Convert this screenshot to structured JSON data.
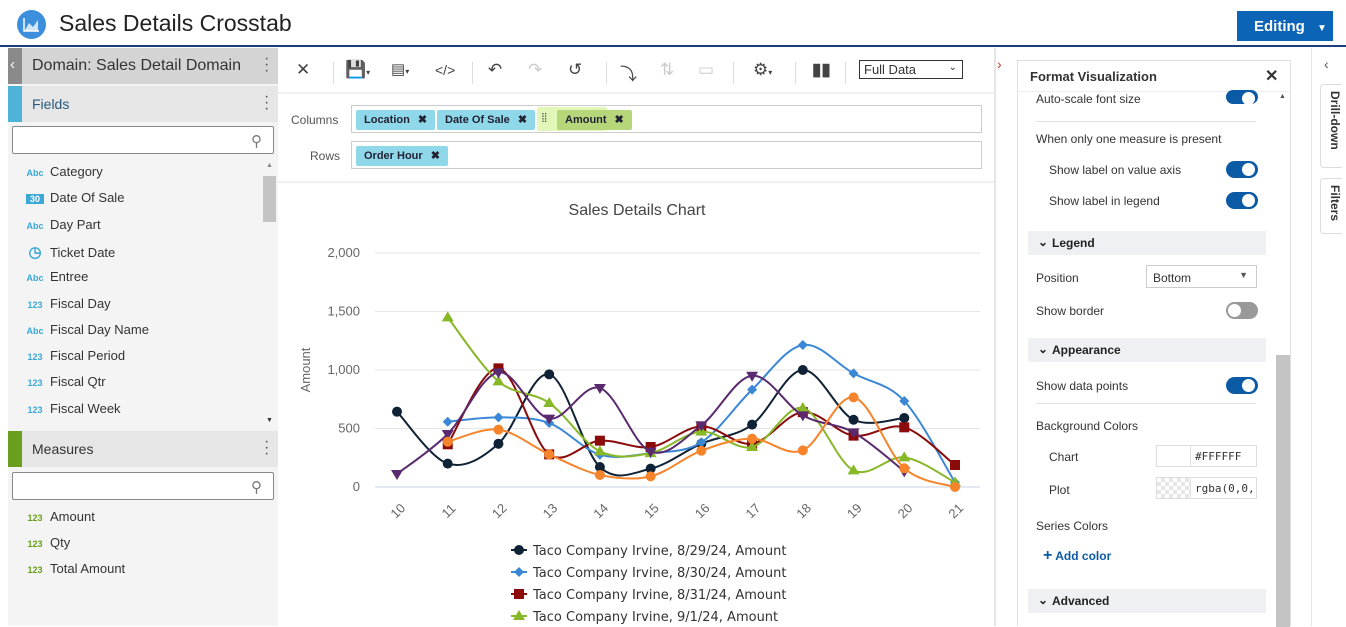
{
  "header": {
    "title": "Sales Details Crosstab",
    "editing_label": "Editing",
    "editing_caret": "▼"
  },
  "left_panel": {
    "domain_label": "Domain: Sales Detail Domain",
    "fields_label": "Fields",
    "fields_search_placeholder": "",
    "fields": [
      {
        "type": "Abc",
        "label": "Category"
      },
      {
        "type": "30",
        "label": "Date Of Sale"
      },
      {
        "type": "Abc",
        "label": "Day Part"
      },
      {
        "type": "clock",
        "label": "Ticket Date"
      },
      {
        "type": "Abc",
        "label": "Entree"
      },
      {
        "type": "123",
        "label": "Fiscal Day"
      },
      {
        "type": "Abc",
        "label": "Fiscal Day Name"
      },
      {
        "type": "123",
        "label": "Fiscal Period"
      },
      {
        "type": "123",
        "label": "Fiscal Qtr"
      },
      {
        "type": "123",
        "label": "Fiscal Week"
      }
    ],
    "measures_label": "Measures",
    "measures": [
      {
        "type": "123",
        "label": "Amount"
      },
      {
        "type": "123",
        "label": "Qty"
      },
      {
        "type": "123",
        "label": "Total Amount"
      }
    ],
    "colors": {
      "fields_stripe": "#4fb3d9",
      "measures_stripe": "#6a9e1f"
    }
  },
  "toolbar": {
    "data_mode": "Full Data",
    "icons": [
      "close-icon",
      "save-icon",
      "export-icon",
      "code-icon",
      "undo-icon",
      "redo-icon",
      "reset-icon",
      "swap-axes-icon",
      "sort-icon",
      "layout-icon",
      "settings-icon",
      "chart-type-icon"
    ]
  },
  "shelves": {
    "columns_label": "Columns",
    "columns": [
      "Location",
      "Date Of Sale",
      "Amount"
    ],
    "rows_label": "Rows",
    "rows": [
      "Order Hour"
    ],
    "remove_glyph": "✖"
  },
  "chart_data": {
    "type": "line",
    "title": "Sales Details Chart",
    "xlabel": "",
    "ylabel": "Amount",
    "categories": [
      "10",
      "11",
      "12",
      "13",
      "14",
      "15",
      "16",
      "17",
      "18",
      "19",
      "20",
      "21"
    ],
    "yticks": [
      "0",
      "500",
      "1,000",
      "1,500",
      "2,000"
    ],
    "ylim": [
      0,
      2000
    ],
    "grid": true,
    "smooth": true,
    "legend_position": "bottom",
    "series": [
      {
        "name": "Taco Company Irvine, 8/29/24, Amount",
        "color": "#0f2236",
        "marker": "circle",
        "values": [
          644,
          200,
          370,
          963,
          171,
          157,
          370,
          533,
          1000,
          575,
          590,
          null
        ]
      },
      {
        "name": "Taco Company Irvine, 8/30/24, Amount",
        "color": "#3a87d6",
        "marker": "diamond",
        "values": [
          null,
          558,
          595,
          547,
          276,
          290,
          382,
          832,
          1214,
          971,
          735,
          40
        ]
      },
      {
        "name": "Taco Company Irvine, 8/31/24, Amount",
        "color": "#8b0a0a",
        "marker": "square",
        "values": [
          null,
          365,
          1014,
          279,
          396,
          342,
          518,
          370,
          640,
          439,
          510,
          188
        ]
      },
      {
        "name": "Taco Company Irvine, 9/1/24, Amount",
        "color": "#88b827",
        "marker": "triangle",
        "values": [
          null,
          1450,
          903,
          718,
          305,
          290,
          473,
          342,
          675,
          142,
          253,
          40
        ]
      },
      {
        "color": "#5a2a6e",
        "marker": "triangle-down",
        "values": [
          111,
          453,
          980,
          584,
          846,
          302,
          527,
          951,
          612,
          467,
          134,
          null
        ]
      },
      {
        "color": "#f5842b",
        "marker": "circle",
        "values": [
          null,
          387,
          490,
          279,
          103,
          91,
          310,
          413,
          313,
          766,
          160,
          0
        ]
      }
    ]
  },
  "format_panel": {
    "title": "Format Visualization",
    "auto_scale": "Auto-scale font size",
    "one_measure": "When only one measure is present",
    "show_label_axis": "Show label on value axis",
    "show_label_legend": "Show label in legend",
    "legend_section": "Legend",
    "position_label": "Position",
    "position_value": "Bottom",
    "show_border": "Show border",
    "appearance_section": "Appearance",
    "show_points": "Show data points",
    "bg_colors": "Background Colors",
    "chart_label": "Chart",
    "chart_value": "#FFFFFF",
    "plot_label": "Plot",
    "plot_value": "rgba(0,0,",
    "series_colors": "Series Colors",
    "add_color": "Add color",
    "advanced_section": "Advanced",
    "toggles": {
      "auto_scale": true,
      "show_label_axis": true,
      "show_label_legend": true,
      "show_border": false,
      "show_points": true
    }
  },
  "side_tabs": [
    "Drill-down",
    "Filters"
  ]
}
